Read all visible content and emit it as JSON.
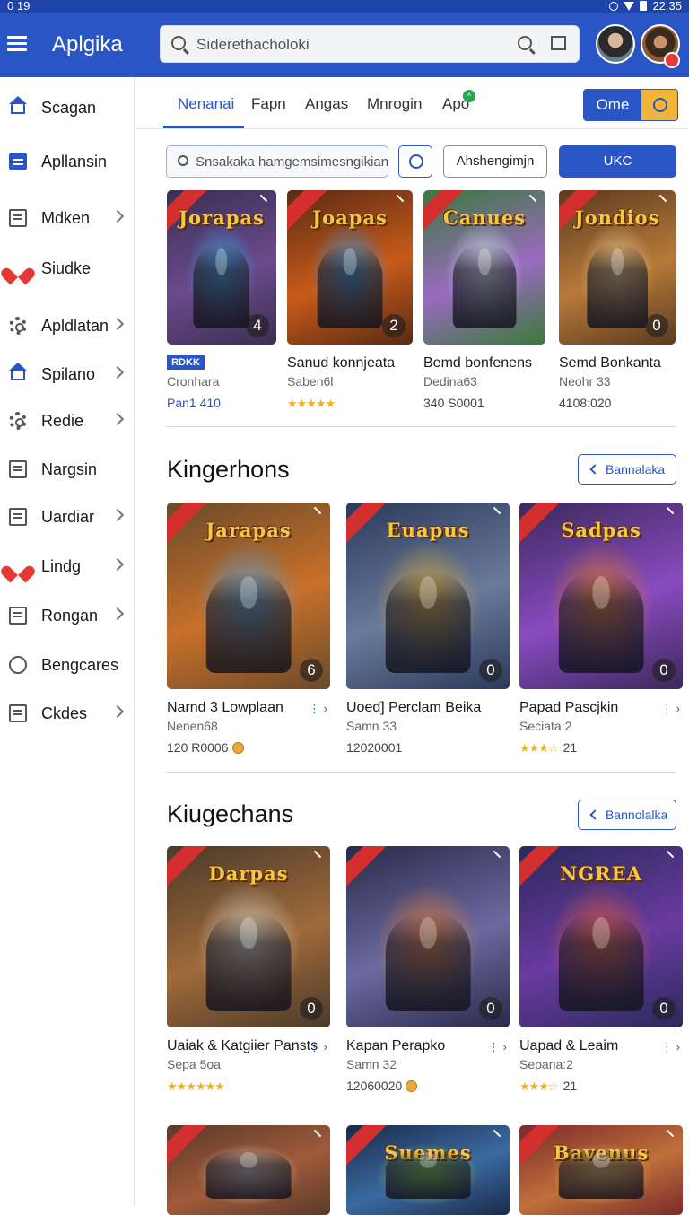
{
  "status": {
    "time": "0 19",
    "right_text": "22:35"
  },
  "app": {
    "title": "Aplgika"
  },
  "search": {
    "placeholder": "Siderethacholoki"
  },
  "sidebar": {
    "items": [
      {
        "label": "Scagan",
        "icon": "home-icon",
        "chevron": false
      },
      {
        "label": "Apllansin",
        "icon": "document-icon",
        "chevron": false
      },
      {
        "label": "Mdken",
        "icon": "list-icon",
        "chevron": true
      },
      {
        "label": "Siudke",
        "icon": "heart-icon",
        "chevron": false
      },
      {
        "label": "Apldlatan",
        "icon": "gear-icon",
        "chevron": true
      },
      {
        "label": "Spilano",
        "icon": "home-icon",
        "chevron": true
      },
      {
        "label": "Redie",
        "icon": "gear-icon",
        "chevron": true
      },
      {
        "label": "Nargsin",
        "icon": "list-icon",
        "chevron": false
      },
      {
        "label": "Uardiar",
        "icon": "list-icon",
        "chevron": true
      },
      {
        "label": "Lindg",
        "icon": "heart-icon",
        "chevron": true
      },
      {
        "label": "Rongan",
        "icon": "list-icon",
        "chevron": true
      },
      {
        "label": "Bengcares",
        "icon": "round-icon",
        "chevron": false
      },
      {
        "label": "Ckdes",
        "icon": "list-icon",
        "chevron": true
      }
    ]
  },
  "tabs": {
    "items": [
      "Nenanai",
      "Fapn",
      "Angas",
      "Mnrogin",
      "Apo"
    ],
    "active": 0,
    "badge": "^"
  },
  "segmented": {
    "label": "Ome"
  },
  "filter": {
    "placeholder": "Snsakaka hamgemsimesngikian",
    "button_label": "Ahshengimjn",
    "primary_label": "UKC"
  },
  "row1": {
    "cards": [
      {
        "art": "Jorapas",
        "count": "4",
        "badge": "RDKK",
        "sub": "Cronhara",
        "meta": "Pan1 410",
        "meta_blue": true,
        "colors": [
          "#3a2f52",
          "#6a4a8c",
          "#3aa0d8"
        ],
        "title": ""
      },
      {
        "art": "Joapas",
        "count": "2",
        "title": "Sanud konnjeata",
        "sub": "Saben6l",
        "stars": "★★★★★",
        "colors": [
          "#5a2a14",
          "#c85a1a",
          "#3a9ae0"
        ]
      },
      {
        "art": "Canues",
        "count": "",
        "title": "Bemd bonfenens",
        "sub": "Dedina63",
        "meta": "340 S0001",
        "colors": [
          "#3a7a3a",
          "#9a6ac0",
          "#d8e8f0"
        ]
      },
      {
        "art": "Jondios",
        "count": "0",
        "title": "Semd Bonkanta",
        "sub": "Neohr 33",
        "meta": "4108:020",
        "colors": [
          "#5a3a1e",
          "#b87a3a",
          "#e8c88a"
        ]
      }
    ]
  },
  "section1": {
    "title": "Kingerhons",
    "button": "Bannalaka"
  },
  "row2": {
    "cards": [
      {
        "art": "Jarapas",
        "count": "6",
        "title": "Narnd 3 Lowplaan",
        "sub": "Nenen68",
        "meta": "120 R0006",
        "coin": true,
        "colors": [
          "#6a4a2a",
          "#c8702a",
          "#5aa0d0"
        ]
      },
      {
        "art": "Euapus",
        "count": "0",
        "title": "Uoed] Perclam Beika",
        "sub": "Samn 33",
        "meta": "12020001",
        "colors": [
          "#2a3a5a",
          "#6a7a9a",
          "#d8a83a"
        ]
      },
      {
        "art": "Sadpas",
        "count": "0",
        "title": "Papad Pascjkin",
        "sub": "Seciata:2",
        "stars": "★★★☆",
        "rating": "21",
        "colors": [
          "#3a2a5a",
          "#8a4ac0",
          "#e07a2a"
        ]
      }
    ]
  },
  "section2": {
    "title": "Kiugechans",
    "button": "Bannolalka"
  },
  "row3": {
    "cards": [
      {
        "art": "Darpas",
        "count": "0",
        "title": "Uaiak & Katgiier Pansts",
        "sub": "Sepa 5oa",
        "stars": "★★★★★★",
        "colors": [
          "#4a3a2a",
          "#a06a3a",
          "#d8d0c0"
        ]
      },
      {
        "art": "",
        "count": "0",
        "title": "Kapan Perapko",
        "sub": "Samn 32",
        "meta": "12060020",
        "coin": true,
        "colors": [
          "#2a2a4a",
          "#6a6aa0",
          "#e07a3a"
        ]
      },
      {
        "art": "NGREA",
        "count": "0",
        "title": "Uapad & Leaim",
        "sub": "Sepana:2",
        "stars": "★★★☆",
        "rating": "21",
        "colors": [
          "#2a2a5a",
          "#6a3aa0",
          "#e05a3a"
        ]
      }
    ]
  },
  "row4": {
    "cards": [
      {
        "art": "",
        "colors": [
          "#5a3a2a",
          "#a05a3a",
          "#d8d0c8"
        ]
      },
      {
        "art": "Suemes",
        "colors": [
          "#1a2a4a",
          "#3a6aa0",
          "#8ad040"
        ]
      },
      {
        "art": "Bavenus",
        "colors": [
          "#7a2a2a",
          "#c0703a",
          "#e8c060"
        ]
      }
    ]
  }
}
